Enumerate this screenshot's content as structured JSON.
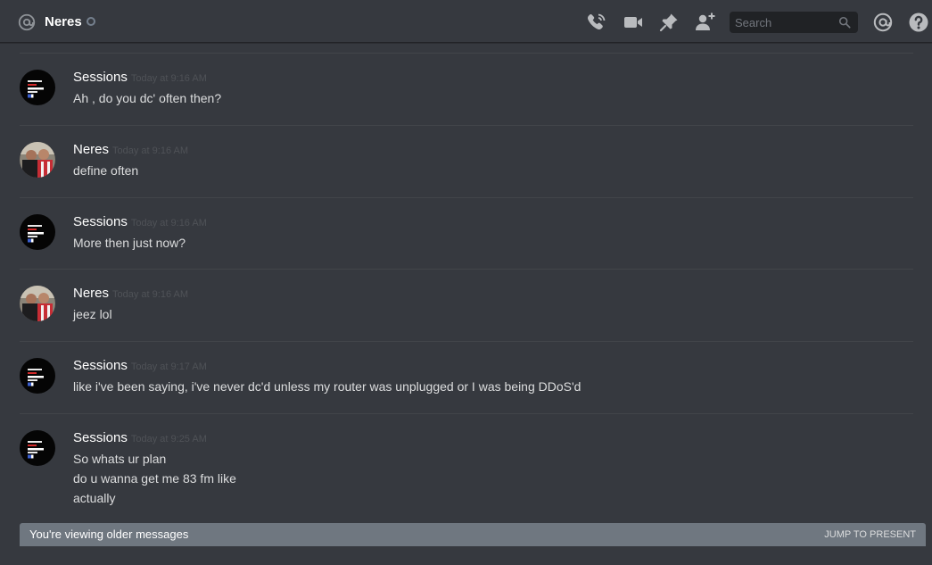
{
  "header": {
    "channel_name": "Neres",
    "search_placeholder": "Search",
    "icons": [
      "at-icon",
      "voice-call-icon",
      "video-call-icon",
      "pin-icon",
      "add-friend-icon",
      "search-icon",
      "mentions-icon",
      "help-icon"
    ]
  },
  "messages": [
    {
      "author": "Sessions",
      "timestamp": "Today at 9:16 AM",
      "avatar": "sessions-avatar",
      "lines": [
        "Ah , do you dc' often then?"
      ]
    },
    {
      "author": "Neres",
      "timestamp": "Today at 9:16 AM",
      "avatar": "neres-avatar",
      "lines": [
        "define often"
      ]
    },
    {
      "author": "Sessions",
      "timestamp": "Today at 9:16 AM",
      "avatar": "sessions-avatar",
      "lines": [
        "More then just now?"
      ]
    },
    {
      "author": "Neres",
      "timestamp": "Today at 9:16 AM",
      "avatar": "neres-avatar",
      "lines": [
        "jeez lol"
      ]
    },
    {
      "author": "Sessions",
      "timestamp": "Today at 9:17 AM",
      "avatar": "sessions-avatar",
      "lines": [
        "like i've been saying, i've never dc'd unless my router was unplugged or I was being DDoS'd"
      ]
    },
    {
      "author": "Sessions",
      "timestamp": "Today at 9:25 AM",
      "avatar": "sessions-avatar",
      "lines": [
        "So whats ur plan",
        "do u wanna get me 83 fm like",
        "actually"
      ]
    }
  ],
  "older_bar": {
    "text": "You're viewing older messages",
    "jump_label": "JUMP TO PRESENT"
  },
  "colors": {
    "background": "#36393f",
    "search_bg": "#202225",
    "older_bar_bg": "#6f7780",
    "username": "#ffffff",
    "timestamp": "#4f5257",
    "text": "#dcddde"
  }
}
